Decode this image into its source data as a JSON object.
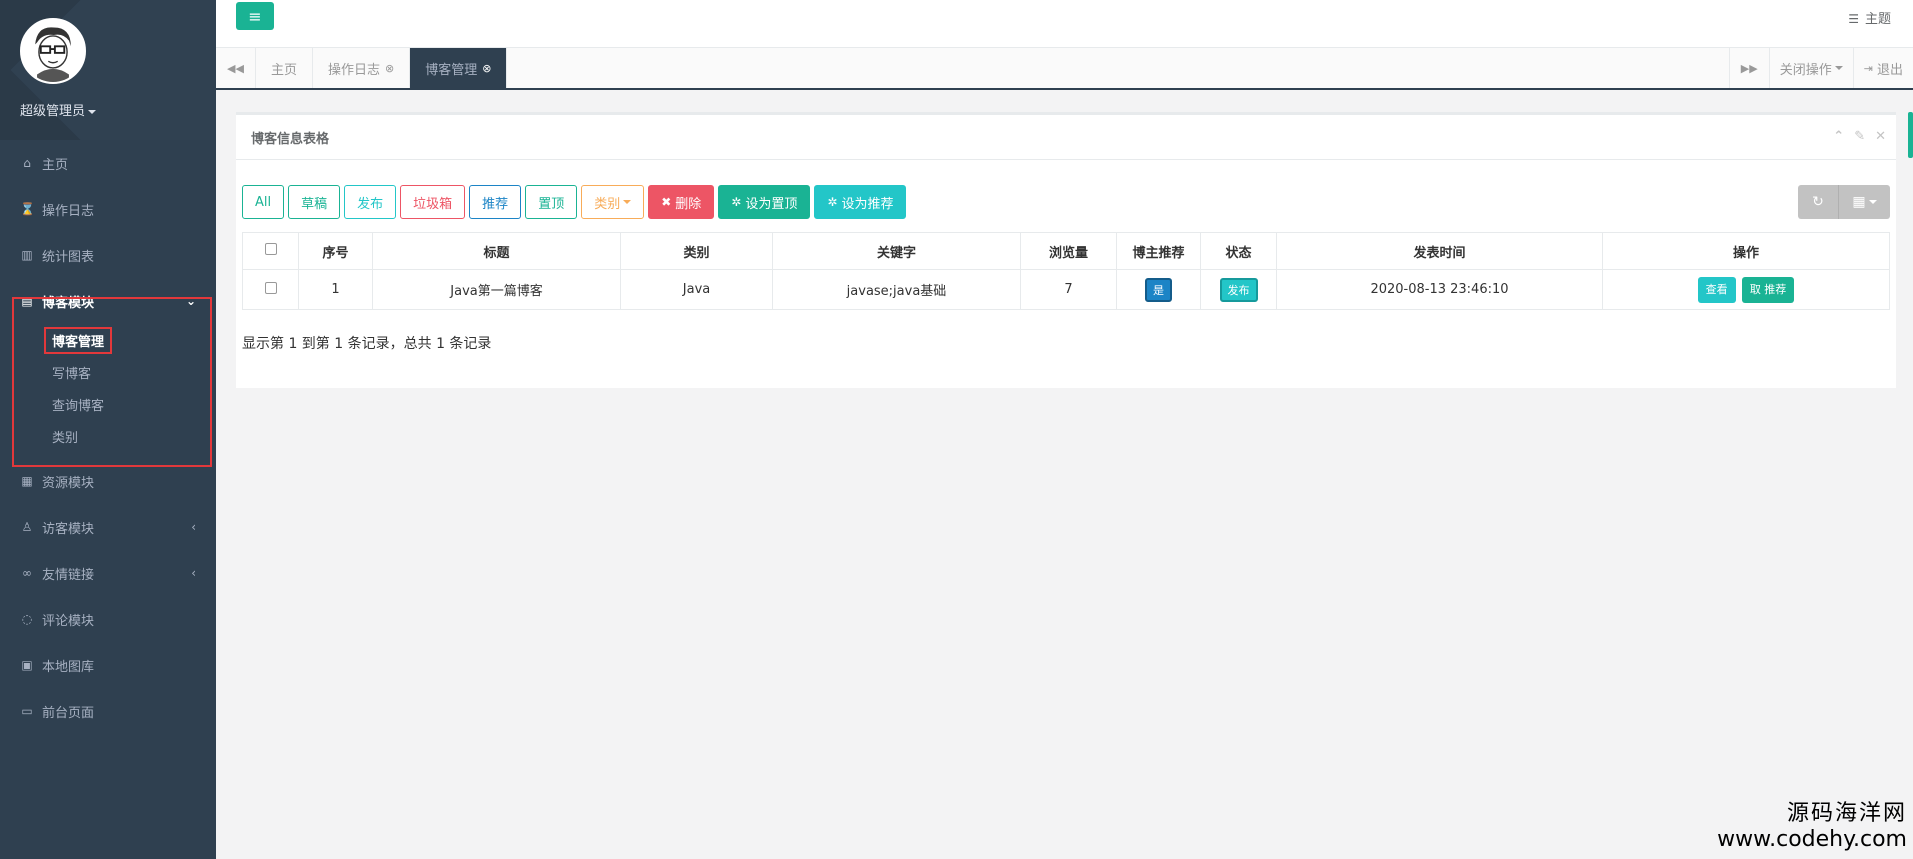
{
  "sidebar": {
    "admin_name": "超级管理员",
    "items": [
      {
        "label": "主页",
        "icon": "home-icon"
      },
      {
        "label": "操作日志",
        "icon": "hourglass-icon"
      },
      {
        "label": "统计图表",
        "icon": "bar-chart-icon"
      },
      {
        "label": "博客模块",
        "icon": "book-icon"
      },
      {
        "label": "资源模块",
        "icon": "table-icon"
      },
      {
        "label": "访客模块",
        "icon": "user-icon"
      },
      {
        "label": "友情链接",
        "icon": "link-icon"
      },
      {
        "label": "评论模块",
        "icon": "comment-icon"
      },
      {
        "label": "本地图库",
        "icon": "image-icon"
      },
      {
        "label": "前台页面",
        "icon": "desktop-icon"
      }
    ],
    "blog_subitems": [
      {
        "label": "博客管理"
      },
      {
        "label": "写博客"
      },
      {
        "label": "查询博客"
      },
      {
        "label": "类别"
      }
    ]
  },
  "topbar": {
    "theme_label": "主题"
  },
  "tabs": {
    "items": [
      {
        "label": "主页"
      },
      {
        "label": "操作日志"
      },
      {
        "label": "博客管理"
      }
    ],
    "close_ops_label": "关闭操作",
    "logout_label": "退出"
  },
  "panel": {
    "title": "博客信息表格",
    "toolbar": {
      "all": "All",
      "draft": "草稿",
      "publish": "发布",
      "trash": "垃圾箱",
      "recommend": "推荐",
      "top": "置顶",
      "category": "类别",
      "delete": "删除",
      "set_top": "设为置顶",
      "set_recommend": "设为推荐"
    },
    "table": {
      "headers": [
        "序号",
        "标题",
        "类别",
        "关键字",
        "浏览量",
        "博主推荐",
        "状态",
        "发表时间",
        "操作"
      ],
      "rows": [
        {
          "index": "1",
          "title": "Java第一篇博客",
          "category": "Java",
          "keywords": "javase;java基础",
          "views": "7",
          "recommend": "是",
          "status": "发布",
          "time": "2020-08-13 23:46:10",
          "view_btn": "查看",
          "unrecommend_btn": "取 推荐"
        }
      ]
    },
    "pager_info": "显示第 1 到第 1 条记录，总共 1 条记录"
  },
  "watermark": {
    "line1": "源码海洋网",
    "line2": "www.codehy.com"
  },
  "colors": {
    "sidebar_bg": "#2f4050",
    "primary": "#1ab394",
    "info": "#23c6c8",
    "danger": "#ed5565",
    "highlight_box": "#e3383b"
  }
}
